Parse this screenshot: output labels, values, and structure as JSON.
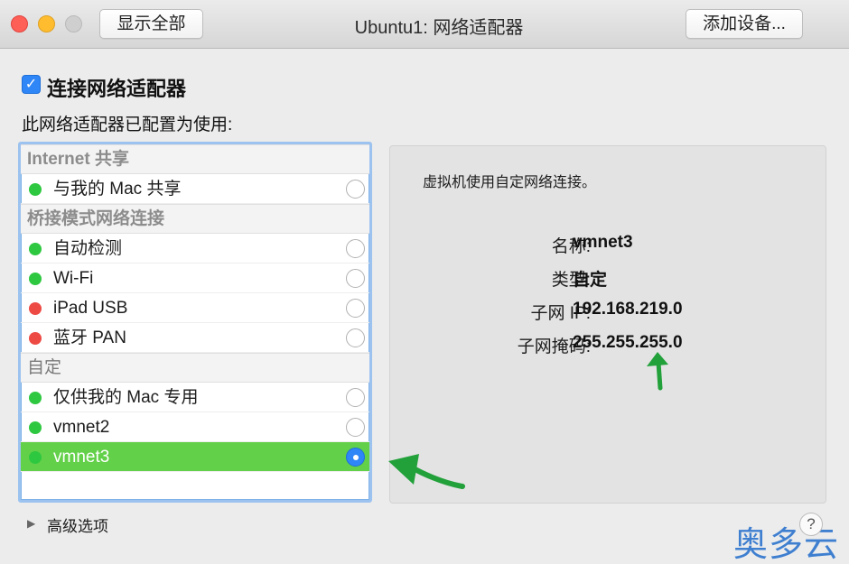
{
  "window": {
    "title": "Ubuntu1: 网络适配器",
    "show_all_label": "显示全部",
    "add_device_label": "添加设备..."
  },
  "connect": {
    "checked": true,
    "check_glyph": "✓",
    "label": "连接网络适配器"
  },
  "config_label": "此网络适配器已配置为使用:",
  "list": {
    "sections": [
      {
        "title": "Internet 共享",
        "rows": [
          {
            "label": "与我的 Mac 共享",
            "status": "green",
            "selected": false
          }
        ]
      },
      {
        "title": "桥接模式网络连接",
        "rows": [
          {
            "label": "自动检测",
            "status": "green",
            "selected": false
          },
          {
            "label": "Wi-Fi",
            "status": "green",
            "selected": false
          },
          {
            "label": "iPad USB",
            "status": "red",
            "selected": false
          },
          {
            "label": "蓝牙 PAN",
            "status": "red",
            "selected": false
          }
        ]
      },
      {
        "title": "自定",
        "rows": [
          {
            "label": "仅供我的 Mac 专用",
            "status": "green",
            "selected": false
          },
          {
            "label": "vmnet2",
            "status": "green",
            "selected": false
          },
          {
            "label": "vmnet3",
            "status": "green",
            "selected": true
          }
        ]
      }
    ]
  },
  "panel": {
    "description": "虚拟机使用自定网络连接。",
    "fields": [
      {
        "key": "名称:",
        "value": "vmnet3"
      },
      {
        "key": "类型:",
        "value": "自定"
      },
      {
        "key": "子网 IP:",
        "value": "192.168.219.0"
      },
      {
        "key": "子网掩码:",
        "value": "255.255.255.0"
      }
    ]
  },
  "advanced": {
    "triangle_glyph": "▶",
    "label": "高级选项"
  },
  "help_glyph": "?",
  "watermark": "奥多云",
  "colors": {
    "green": "#2ec840",
    "red": "#ee4a44",
    "selection": "#62d048",
    "accent": "#2f86f6",
    "arrow": "#22a03a"
  },
  "icons": {
    "close": "close-icon",
    "minimize": "minimize-icon",
    "zoom": "zoom-icon",
    "checkbox": "checkbox-icon",
    "radio": "radio-icon",
    "disclosure": "disclosure-triangle-icon",
    "help": "help-icon"
  }
}
